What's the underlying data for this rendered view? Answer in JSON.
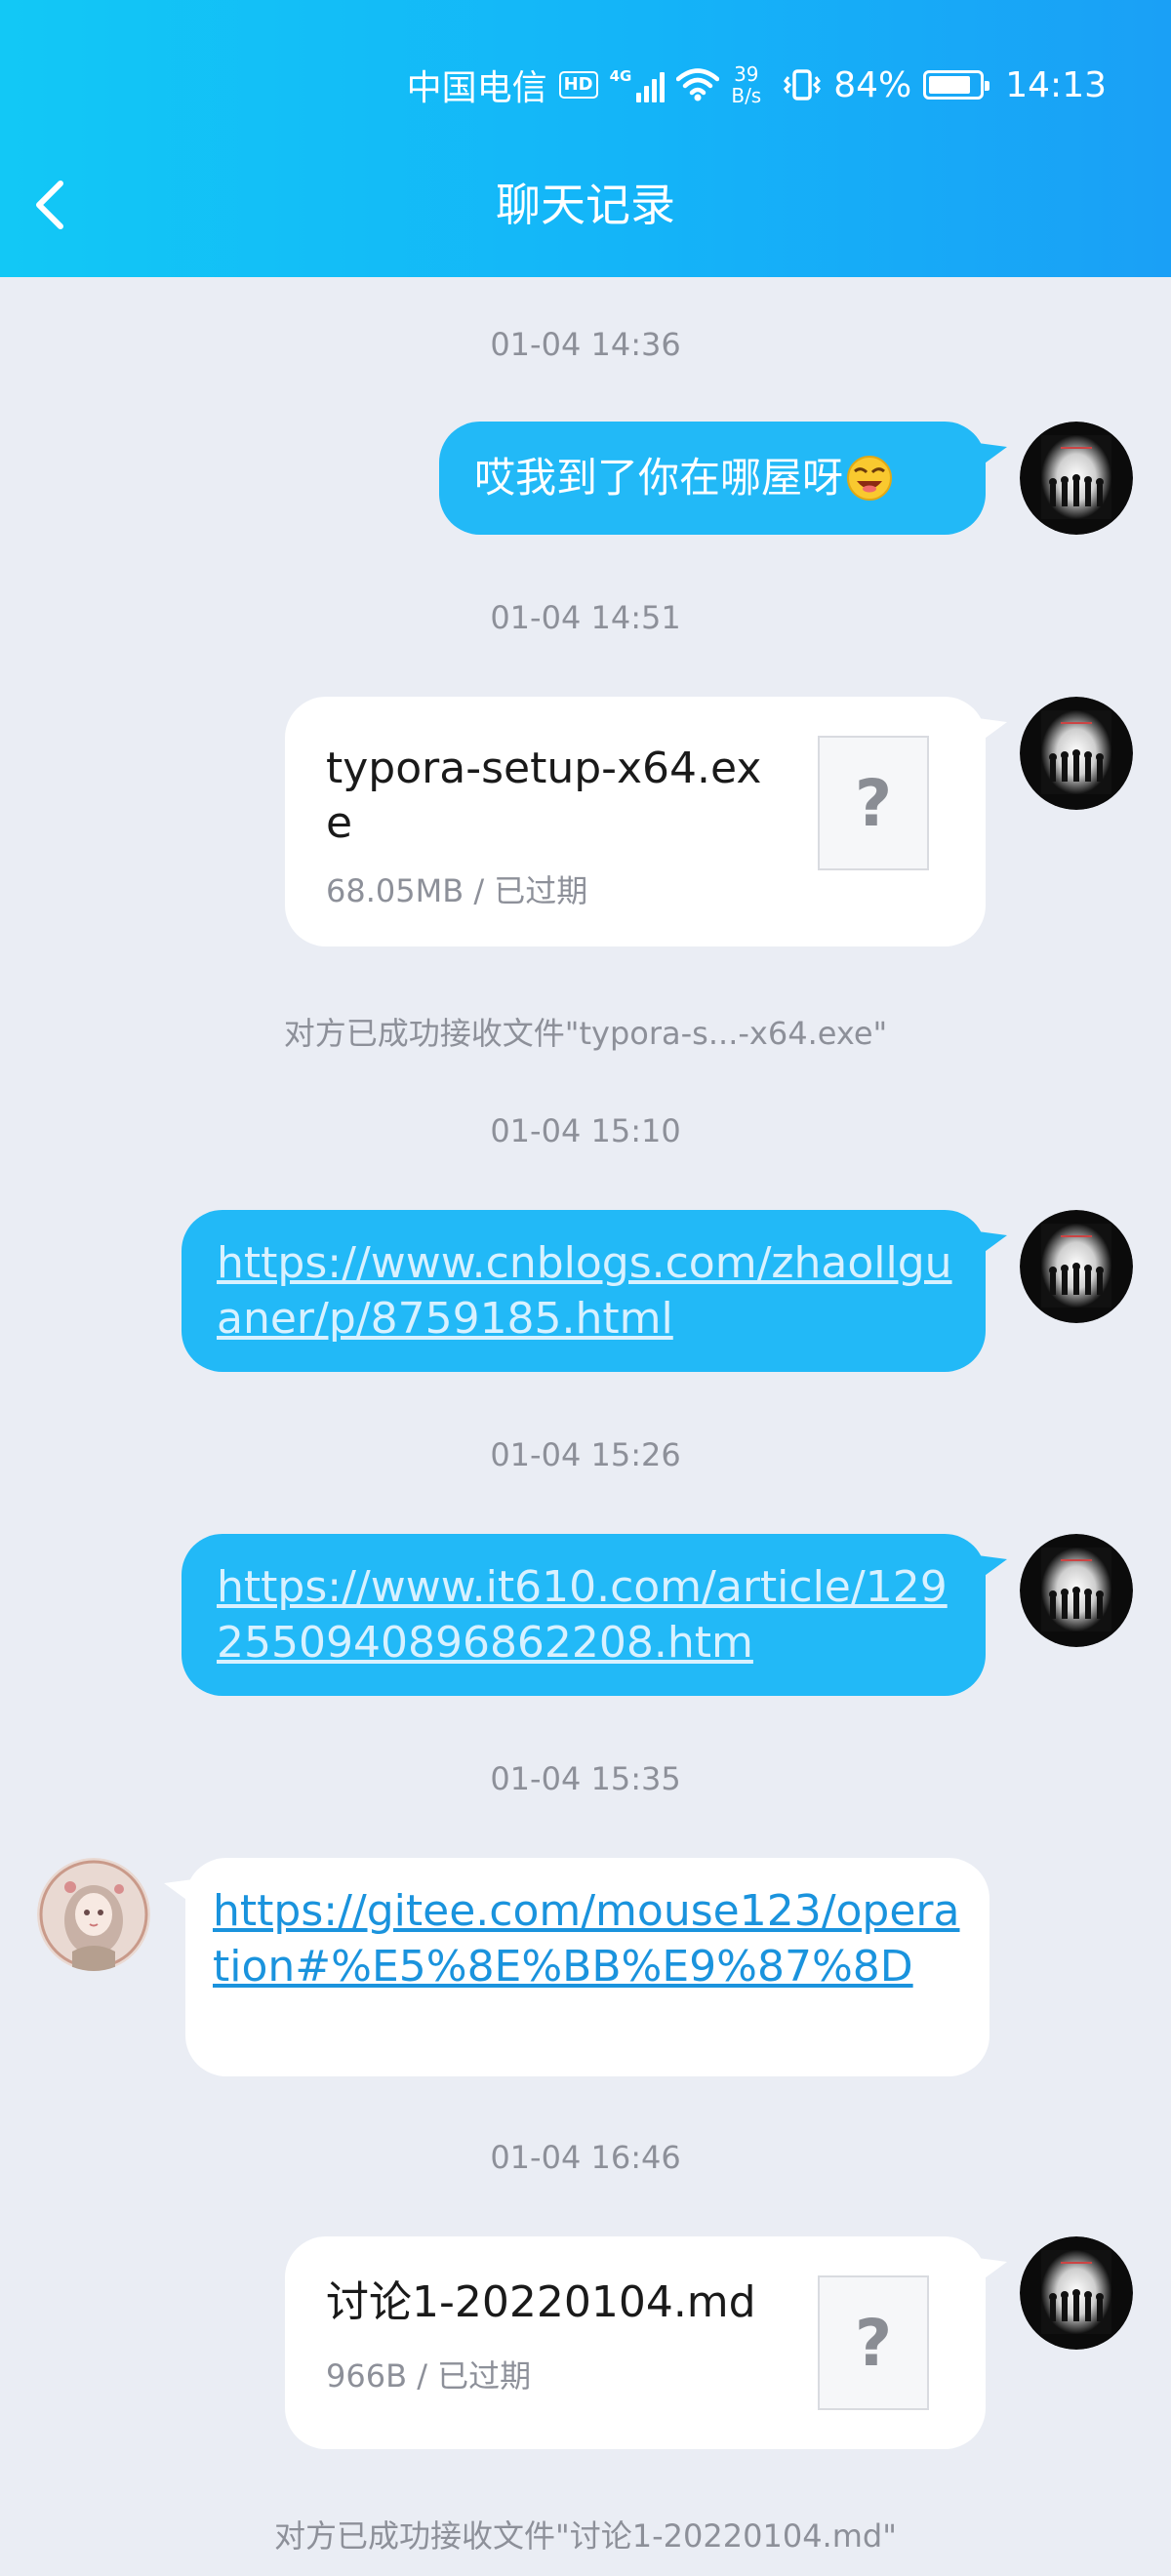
{
  "status_bar": {
    "carrier": "中国电信",
    "hd": "HD",
    "network": "4G",
    "speed_value": "39",
    "speed_unit": "B/s",
    "battery": "84%",
    "time": "14:13"
  },
  "header": {
    "title": "聊天记录",
    "back_icon": "chevron-left-icon"
  },
  "colors": {
    "header": "#14b4f8",
    "bubble_me": "#22b9f7",
    "bubble_other": "#ffffff",
    "background": "#eaedf4"
  },
  "messages": [
    {
      "timestamp": "01-04 14:36",
      "sender": "me",
      "type": "text",
      "text": "哎我到了你在哪屋呀",
      "emoji": "laughing-emoji"
    },
    {
      "timestamp": "01-04 14:51",
      "sender": "me",
      "type": "file",
      "file_name": "typora-setup-x64.exe",
      "file_meta": "68.05MB / 已过期",
      "file_icon": "?",
      "receipt": "对方已成功接收文件\"typora-s...-x64.exe\""
    },
    {
      "timestamp": "01-04 15:10",
      "sender": "me",
      "type": "link",
      "url": "https://www.cnblogs.com/zhaollguaner/p/8759185.html"
    },
    {
      "timestamp": "01-04 15:26",
      "sender": "me",
      "type": "link",
      "url": "https://www.it610.com/article/1292550940896862208.htm"
    },
    {
      "timestamp": "01-04 15:35",
      "sender": "other",
      "type": "link",
      "url": "https://gitee.com/mouse123/operation#%E5%8E%BB%E9%87%8D"
    },
    {
      "timestamp": "01-04 16:46",
      "sender": "me",
      "type": "file",
      "file_name": "讨论1-20220104.md",
      "file_meta": "966B / 已过期",
      "file_icon": "?",
      "receipt": "对方已成功接收文件\"讨论1-20220104.md\""
    }
  ]
}
